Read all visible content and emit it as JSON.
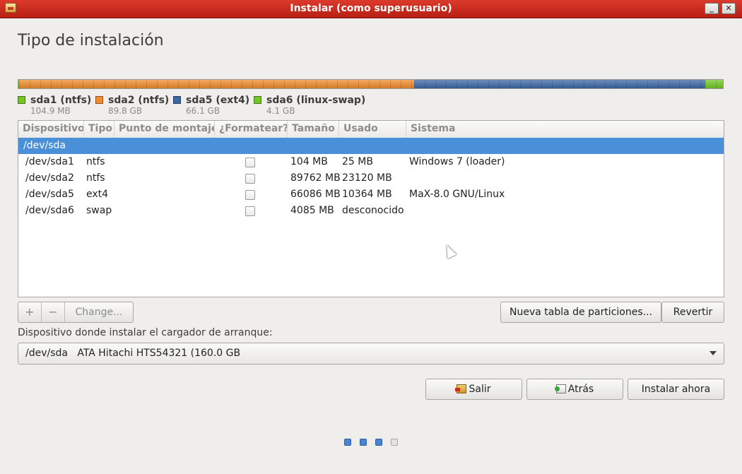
{
  "window": {
    "title": "Instalar (como superusuario)",
    "minimize_glyph": "_",
    "close_glyph": "✕"
  },
  "heading": "Tipo de instalación",
  "colors": {
    "ntfs_green": "#73c724",
    "ntfs_orange": "#f08c2c",
    "ext4_blue": "#3d68a6",
    "swap_green": "#73c724",
    "selection": "#4a90d9"
  },
  "partition_bar": [
    {
      "name": "sda1",
      "fraction": 0.0007,
      "color": "#73c724"
    },
    {
      "name": "sda2",
      "fraction": 0.561,
      "color": "#f08c2c"
    },
    {
      "name": "sda5",
      "fraction": 0.413,
      "color": "#3d68a6"
    },
    {
      "name": "sda6",
      "fraction": 0.0255,
      "color": "#73c724"
    }
  ],
  "legend": [
    {
      "name": "sda1 (ntfs)",
      "size": "104.9 MB",
      "color": "#73c724"
    },
    {
      "name": "sda2 (ntfs)",
      "size": "89.8 GB",
      "color": "#f08c2c"
    },
    {
      "name": "sda5 (ext4)",
      "size": "66.1 GB",
      "color": "#3d68a6"
    },
    {
      "name": "sda6 (linux-swap)",
      "size": "4.1 GB",
      "color": "#73c724"
    }
  ],
  "table": {
    "columns": [
      "Dispositivo",
      "Tipo",
      "Punto de montaje",
      "¿Formatear?",
      "Tamaño",
      "Usado",
      "Sistema"
    ],
    "device_row": "/dev/sda",
    "rows": [
      {
        "device": "/dev/sda1",
        "type": "ntfs",
        "size": "104 MB",
        "used": "25 MB",
        "system": "Windows 7 (loader)"
      },
      {
        "device": "/dev/sda2",
        "type": "ntfs",
        "size": "89762 MB",
        "used": "23120 MB",
        "system": ""
      },
      {
        "device": "/dev/sda5",
        "type": "ext4",
        "size": "66086 MB",
        "used": "10364 MB",
        "system": "MaX-8.0 GNU/Linux"
      },
      {
        "device": "/dev/sda6",
        "type": "swap",
        "size": "4085 MB",
        "used": "desconocido",
        "system": ""
      }
    ]
  },
  "toolbar": {
    "add": "+",
    "remove": "−",
    "change": "Change..."
  },
  "buttons": {
    "new_table": "Nueva tabla de particiones...",
    "revert": "Revertir",
    "quit": "Salir",
    "back": "Atrás",
    "install": "Instalar ahora"
  },
  "bootloader": {
    "label": "Dispositivo donde instalar el cargador de arranque:",
    "value": "/dev/sda   ATA Hitachi HTS54321 (160.0 GB"
  },
  "progress": {
    "total_steps": 4,
    "completed_steps": 3
  }
}
